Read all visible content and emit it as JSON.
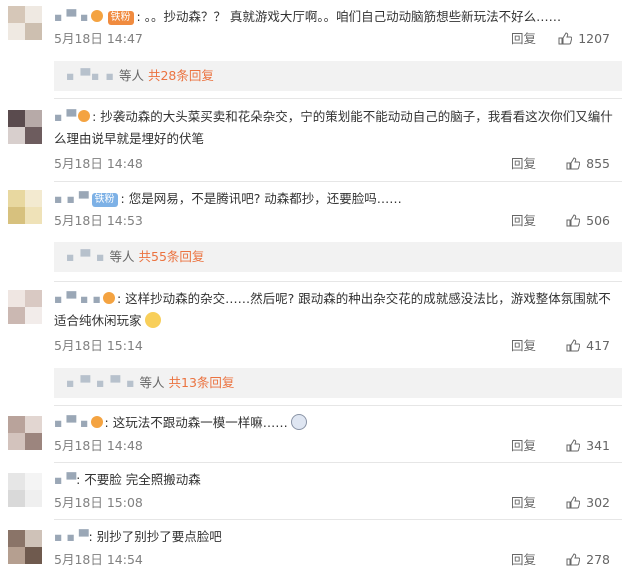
{
  "comments": [
    {
      "user": "▪ ▀ ▪",
      "badge": "铁粉",
      "text": "。。抄动森？？ 真就游戏大厅啊。。咱们自己动动脑筋想些新玩法不好么……",
      "time": "5月18日 14:47",
      "reply_label": "回复",
      "likes": "1207",
      "sub": {
        "users": "▪ ▀▪ ▪",
        "suffix": "等人",
        "count_text": "共28条回复"
      }
    },
    {
      "user": "▪ ▀",
      "badge": "",
      "text": "抄袭动森的大头菜买卖和花朵杂交，宁的策划能不能动动自己的脑子，我看看这次你们又编什么理由说早就是埋好的伏笔",
      "time": "5月18日 14:48",
      "reply_label": "回复",
      "likes": "855"
    },
    {
      "user": "▪ ▪ ▀",
      "badge": "铁粉",
      "text": "您是网易，不是腾讯吧? 动森都抄，还要脸吗……",
      "time": "5月18日 14:53",
      "reply_label": "回复",
      "likes": "506",
      "sub": {
        "users": "▪ ▀ ▪",
        "suffix": "等人",
        "count_text": "共55条回复"
      }
    },
    {
      "user": "▪ ▀ ▪ ▪",
      "badge": "",
      "text": "这样抄动森的杂交……然后呢? 跟动森的种出杂交花的成就感没法比，游戏整体氛围就不适合纯休闲玩家",
      "time": "5月18日 15:14",
      "reply_label": "回复",
      "likes": "417",
      "sub": {
        "users": "▪ ▀ ▪ ▀ ▪",
        "suffix": "等人",
        "count_text": "共13条回复"
      }
    },
    {
      "user": "▪ ▀ ▪",
      "badge": "",
      "text": "这玩法不跟动森一模一样嘛……",
      "time": "5月18日 14:48",
      "reply_label": "回复",
      "likes": "341"
    },
    {
      "user": "▪ ▀",
      "badge": "",
      "text": "不要脸 完全照搬动森",
      "time": "5月18日 15:08",
      "reply_label": "回复",
      "likes": "302"
    },
    {
      "user": "▪ ▪ ▀",
      "badge": "",
      "text": "别抄了别抄了要点脸吧",
      "time": "5月18日 14:54",
      "reply_label": "回复",
      "likes": "278"
    }
  ],
  "colors": {
    "accent_orange": "#eb7340",
    "badge_orange": "#f08b3f",
    "badge_blue": "#7db1e6",
    "muted": "#808080"
  },
  "icons": [
    "thumbs-up-icon",
    "vip-icon",
    "emoji-icon"
  ]
}
